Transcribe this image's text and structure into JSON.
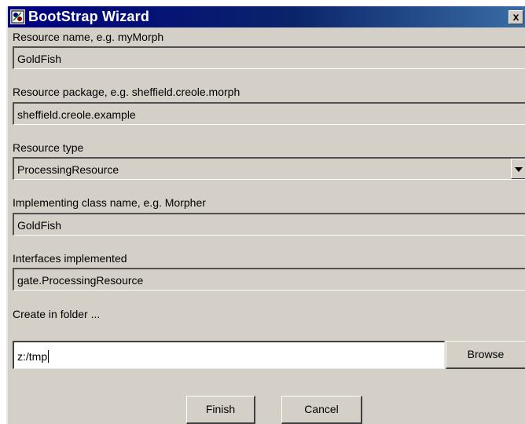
{
  "window": {
    "title": "BootStrap Wizard",
    "close_label": "x",
    "title_bar_color": "#0a246a",
    "background_color": "#d4d0c8"
  },
  "form": {
    "resource_name": {
      "label": "Resource name, e.g. myMorph",
      "value": "GoldFish"
    },
    "resource_package": {
      "label": "Resource package, e.g. sheffield.creole.morph",
      "value": "sheffield.creole.example"
    },
    "resource_type": {
      "label": "Resource type",
      "value": "ProcessingResource"
    },
    "implementing_class": {
      "label": "Implementing class name, e.g. Morpher",
      "value": "GoldFish"
    },
    "interfaces": {
      "label": "Interfaces implemented",
      "value": "gate.ProcessingResource"
    },
    "folder": {
      "label": "Create in folder ...",
      "value": "z:/tmp",
      "browse_label": "Browse"
    }
  },
  "buttons": {
    "finish_label": "Finish",
    "cancel_label": "Cancel"
  },
  "icons": {
    "app": "app-icon",
    "close": "close-icon",
    "dropdown": "chevron-down-icon"
  }
}
